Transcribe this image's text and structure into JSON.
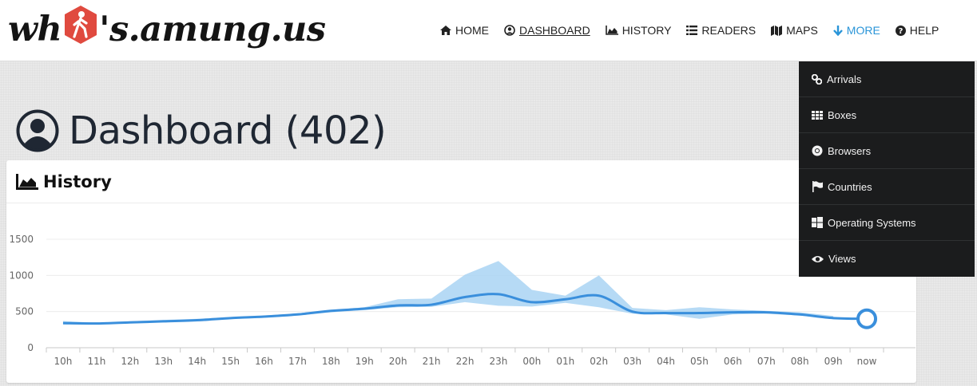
{
  "logo": {
    "pre": "wh",
    "post": "'s.amung.us"
  },
  "nav": {
    "items": [
      {
        "label": "HOME",
        "icon": "home-icon"
      },
      {
        "label": "DASHBOARD",
        "icon": "user-circle-icon"
      },
      {
        "label": "HISTORY",
        "icon": "area-chart-icon"
      },
      {
        "label": "READERS",
        "icon": "list-icon"
      },
      {
        "label": "MAPS",
        "icon": "map-icon"
      },
      {
        "label": "MORE",
        "icon": "arrow-down-icon"
      },
      {
        "label": "HELP",
        "icon": "question-circle-icon"
      }
    ],
    "active": "DASHBOARD"
  },
  "page": {
    "title": "Dashboard (402)"
  },
  "card": {
    "title": "History"
  },
  "dropdown": {
    "items": [
      {
        "label": "Arrivals",
        "icon": "link-icon"
      },
      {
        "label": "Boxes",
        "icon": "grid-icon"
      },
      {
        "label": "Browsers",
        "icon": "chrome-icon"
      },
      {
        "label": "Countries",
        "icon": "flag-icon"
      },
      {
        "label": "Operating Systems",
        "icon": "windows-icon"
      },
      {
        "label": "Views",
        "icon": "eye-icon"
      }
    ]
  },
  "colors": {
    "accent": "#2a95d8",
    "line": "#3a8fdc",
    "band": "#a9d3f3",
    "dark": "#1b1c1d"
  },
  "chart_data": {
    "type": "area",
    "categories": [
      "10h",
      "11h",
      "12h",
      "13h",
      "14h",
      "15h",
      "16h",
      "17h",
      "18h",
      "19h",
      "20h",
      "21h",
      "22h",
      "23h",
      "00h",
      "01h",
      "02h",
      "03h",
      "04h",
      "05h",
      "06h",
      "07h",
      "08h",
      "09h",
      "now"
    ],
    "series": [
      {
        "values": [
          340,
          335,
          350,
          365,
          380,
          410,
          430,
          460,
          510,
          540,
          585,
          595,
          700,
          740,
          630,
          670,
          720,
          500,
          480,
          480,
          490,
          490,
          460,
          410,
          400
        ]
      }
    ],
    "band_upper": [
      370,
      345,
      365,
      385,
      400,
      425,
      445,
      475,
      520,
      560,
      670,
      680,
      1010,
      1200,
      800,
      720,
      1000,
      550,
      520,
      560,
      530,
      510,
      490,
      440,
      400
    ],
    "band_lower": [
      320,
      325,
      340,
      350,
      370,
      395,
      415,
      445,
      490,
      520,
      560,
      565,
      630,
      580,
      570,
      620,
      560,
      470,
      460,
      400,
      460,
      470,
      445,
      400,
      400
    ],
    "yticks": [
      0,
      500,
      1000,
      1500
    ],
    "ylim": [
      0,
      1500
    ],
    "grid": true
  }
}
